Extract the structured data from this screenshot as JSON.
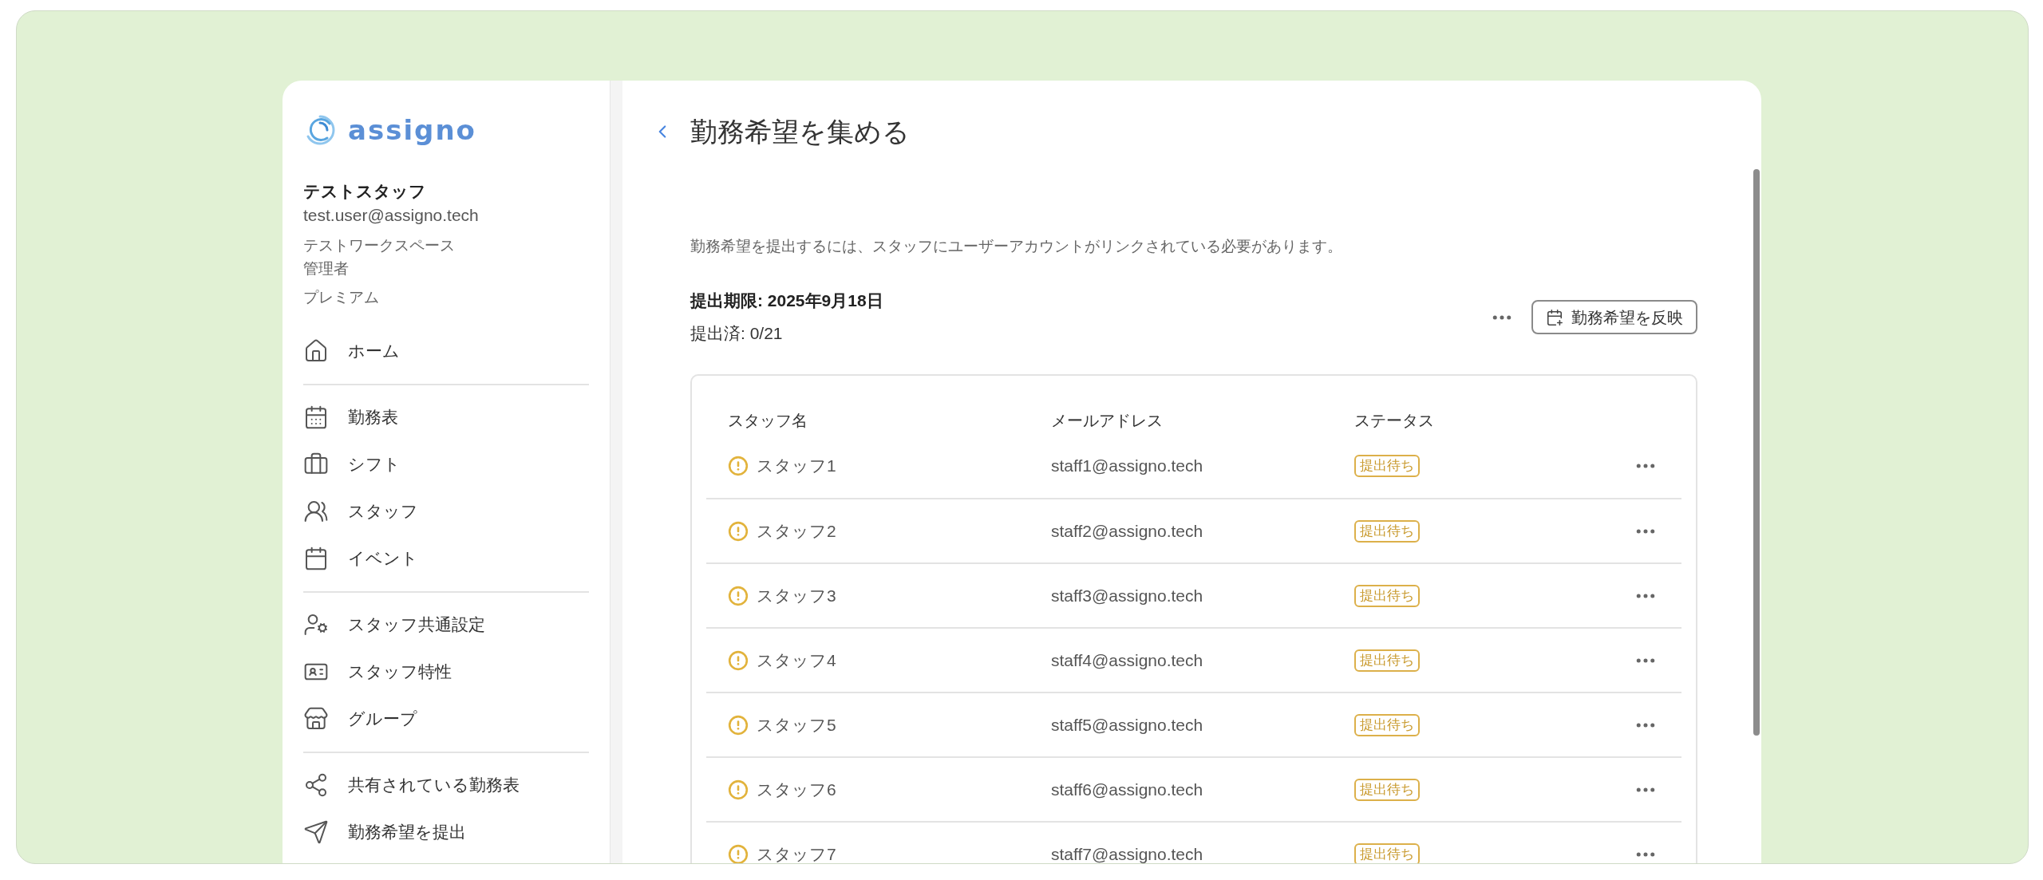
{
  "logo": {
    "text": "assigno"
  },
  "user": {
    "name": "テストスタッフ",
    "email": "test.user@assigno.tech",
    "workspace": "テストワークスペース",
    "role": "管理者",
    "plan": "プレミアム"
  },
  "nav": [
    {
      "items": [
        {
          "label": "ホーム"
        }
      ]
    },
    {
      "items": [
        {
          "label": "勤務表"
        },
        {
          "label": "シフト"
        },
        {
          "label": "スタッフ"
        },
        {
          "label": "イベント"
        }
      ]
    },
    {
      "items": [
        {
          "label": "スタッフ共通設定"
        },
        {
          "label": "スタッフ特性"
        },
        {
          "label": "グループ"
        }
      ]
    },
    {
      "items": [
        {
          "label": "共有されている勤務表"
        },
        {
          "label": "勤務希望を提出"
        }
      ]
    }
  ],
  "page": {
    "title": "勤務希望を集める",
    "notice": "勤務希望を提出するには、スタッフにユーザーアカウントがリンクされている必要があります。",
    "deadline": "提出期限: 2025年9月18日",
    "submitted": "提出済: 0/21",
    "reflect_button": "勤務希望を反映"
  },
  "table": {
    "columns": [
      "スタッフ名",
      "メールアドレス",
      "ステータス"
    ],
    "rows": [
      {
        "name": "スタッフ1",
        "email": "staff1@assigno.tech",
        "status": "提出待ち"
      },
      {
        "name": "スタッフ2",
        "email": "staff2@assigno.tech",
        "status": "提出待ち"
      },
      {
        "name": "スタッフ3",
        "email": "staff3@assigno.tech",
        "status": "提出待ち"
      },
      {
        "name": "スタッフ4",
        "email": "staff4@assigno.tech",
        "status": "提出待ち"
      },
      {
        "name": "スタッフ5",
        "email": "staff5@assigno.tech",
        "status": "提出待ち"
      },
      {
        "name": "スタッフ6",
        "email": "staff6@assigno.tech",
        "status": "提出待ち"
      },
      {
        "name": "スタッフ7",
        "email": "staff7@assigno.tech",
        "status": "提出待ち"
      }
    ]
  }
}
